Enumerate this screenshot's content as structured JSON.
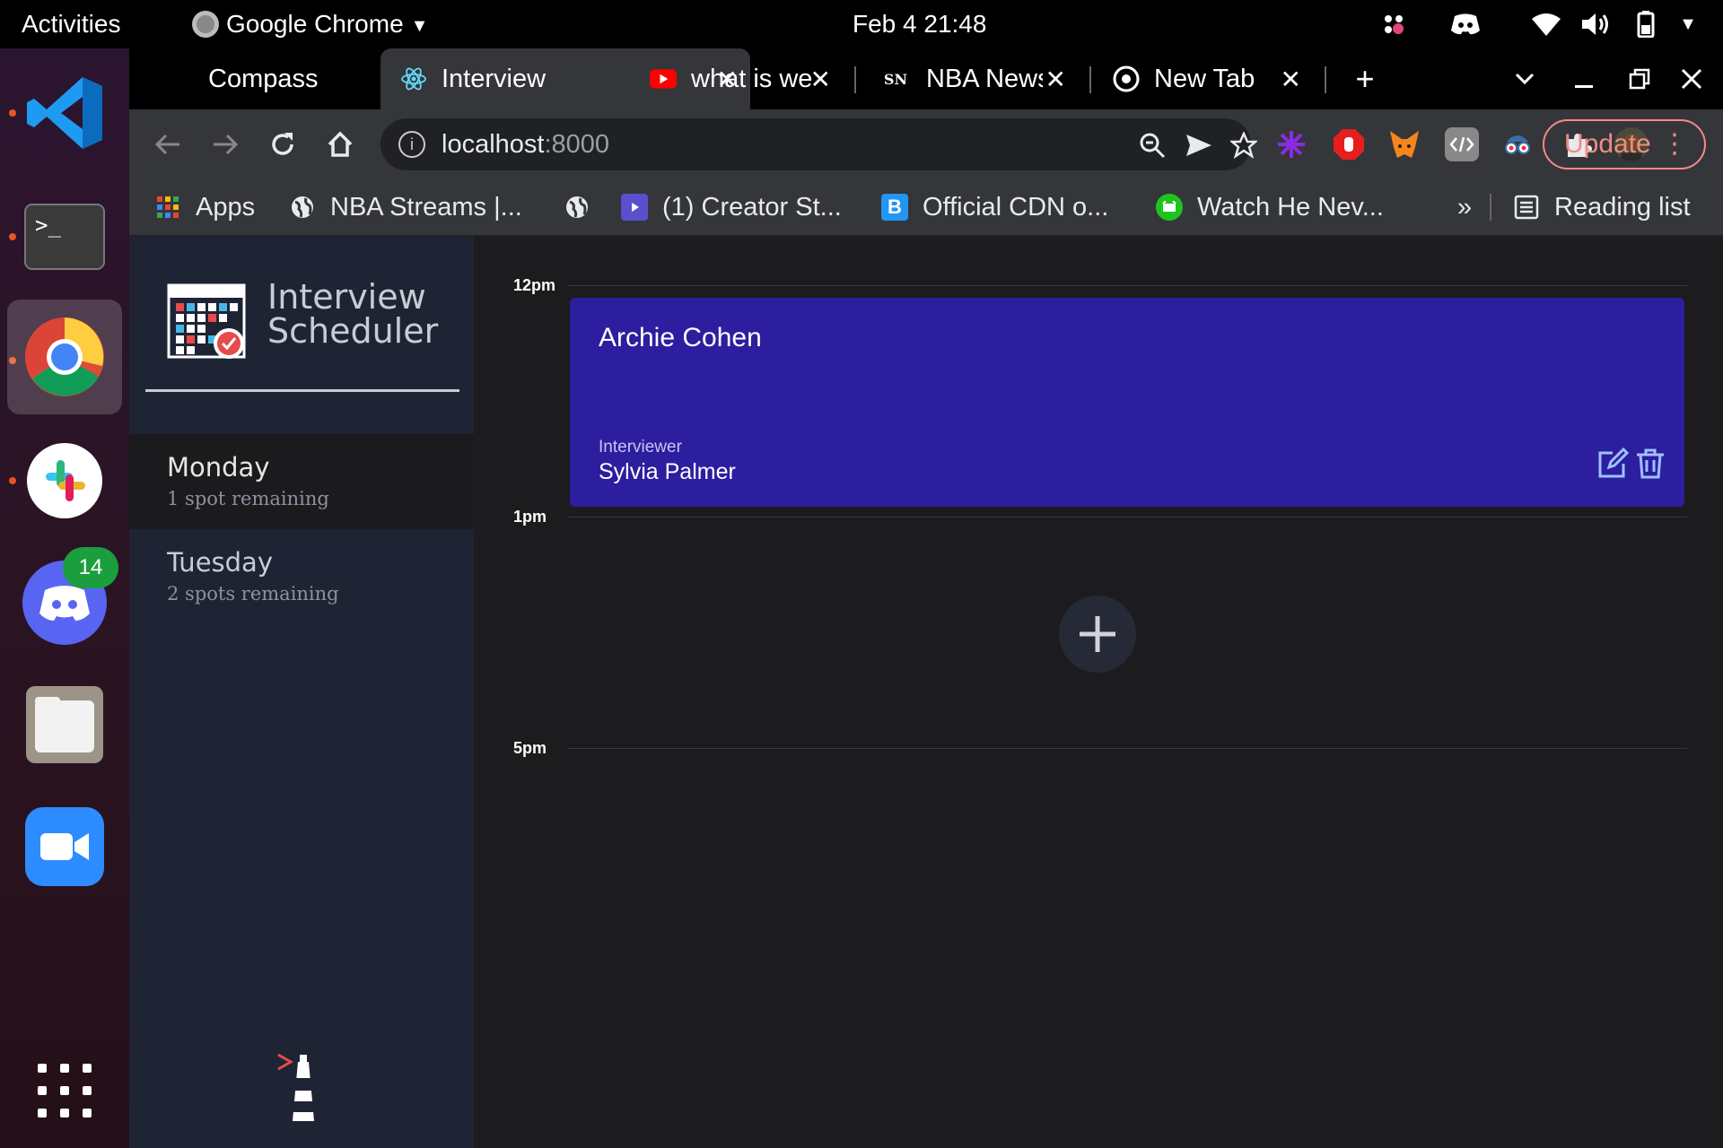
{
  "system": {
    "activities_label": "Activities",
    "app_menu_label": "Google Chrome",
    "clock": "Feb 4  21:48"
  },
  "dock": {
    "discord_badge": "14"
  },
  "browser": {
    "tabs": [
      {
        "title": "Compass",
        "close": "✕"
      },
      {
        "title": "Interview",
        "close": "✕"
      },
      {
        "title": "what is we",
        "close": "✕"
      },
      {
        "title": "NBA News",
        "close": "✕"
      },
      {
        "title": "New Tab",
        "close": "✕"
      }
    ],
    "nba_fav_text": "SN",
    "url_host": "localhost",
    "url_port": ":8000",
    "update_label": "Update",
    "bookmarks": [
      {
        "label": "Apps"
      },
      {
        "label": "NBA Streams |..."
      },
      {
        "label": "(1) Creator St..."
      },
      {
        "label": "Official CDN o..."
      },
      {
        "label": "Watch He Nev..."
      }
    ],
    "bookmarks_more": "»",
    "reading_list_label": "Reading list",
    "cdn_fav_text": "B"
  },
  "app": {
    "title_line1": "Interview",
    "title_line2": "Scheduler",
    "days": [
      {
        "name": "Monday",
        "spots": "1 spot remaining"
      },
      {
        "name": "Tuesday",
        "spots": "2 spots remaining"
      }
    ],
    "times": [
      "12pm",
      "1pm",
      "5pm"
    ],
    "appointment": {
      "student": "Archie Cohen",
      "interviewer_label": "Interviewer",
      "interviewer_name": "Sylvia Palmer"
    }
  },
  "colors": {
    "appointment_bg": "#2c1e9f",
    "sidebar_bg": "#1f2434",
    "update_accent": "#f28b82",
    "ubuntu_orange": "#e95420"
  }
}
